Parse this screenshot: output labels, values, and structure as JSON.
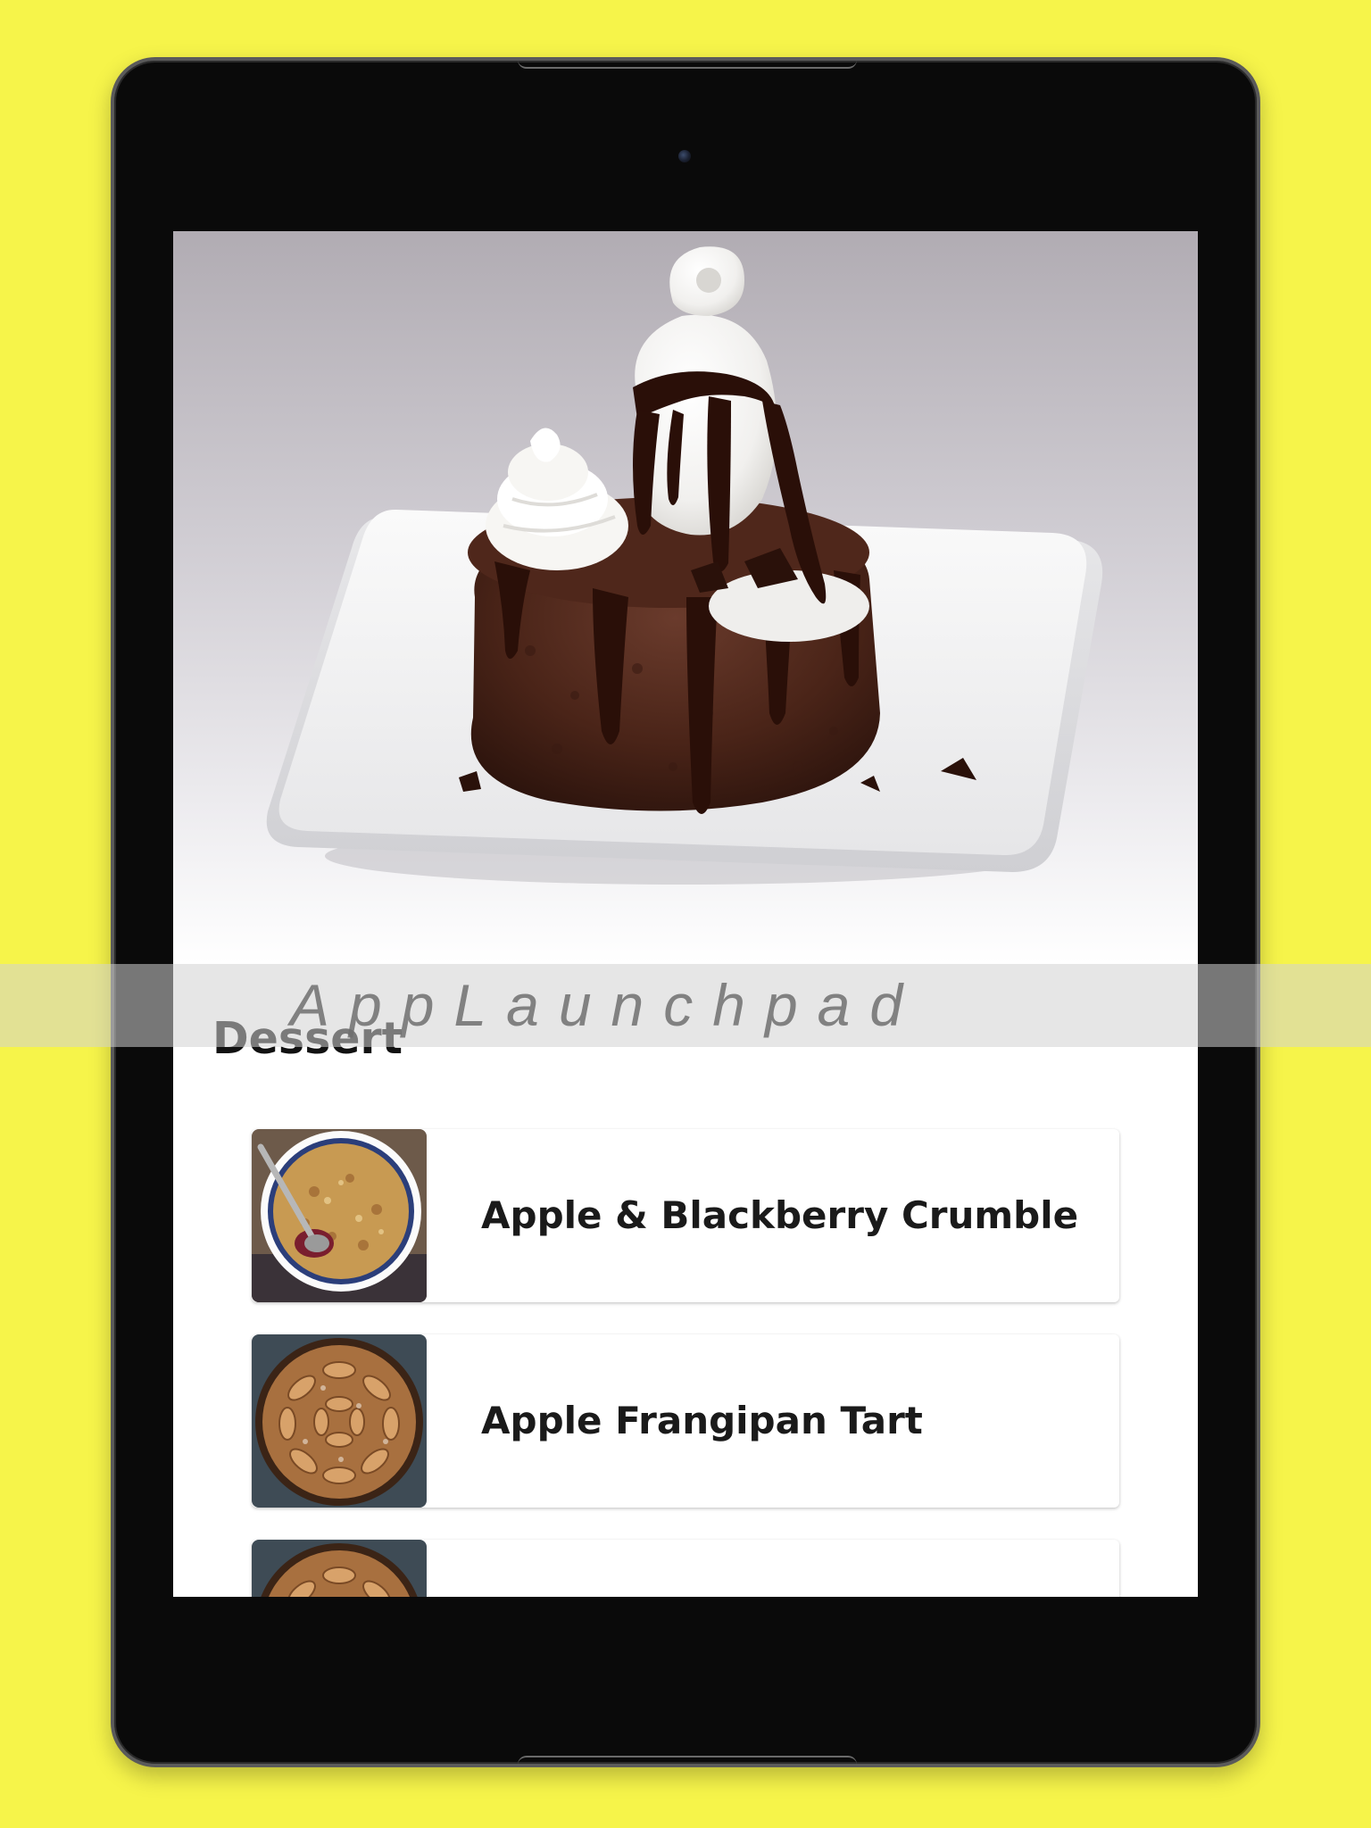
{
  "background_color": "#f6f44a",
  "watermark": {
    "text": "AppLaunchpad"
  },
  "hero": {
    "image": "chocolate-lava-cake-with-ice-cream-image"
  },
  "section": {
    "title": "Dessert"
  },
  "recipes": [
    {
      "title": "Apple & Blackberry Crumble",
      "thumbnail": "crumble-thumbnail"
    },
    {
      "title": "Apple Frangipan Tart",
      "thumbnail": "tart-thumbnail"
    },
    {
      "title": "",
      "thumbnail": "tart-thumbnail"
    }
  ]
}
